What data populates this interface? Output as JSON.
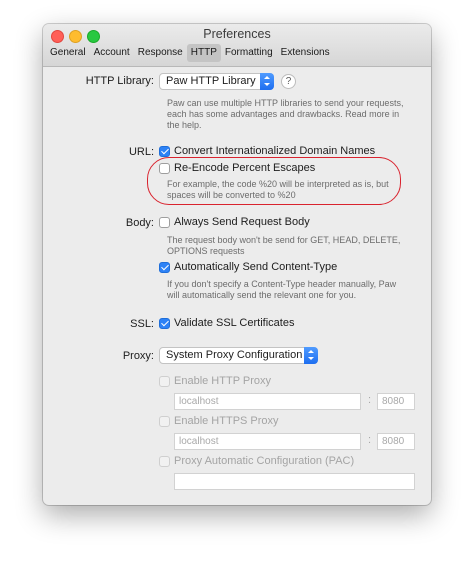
{
  "window": {
    "title": "Preferences",
    "tabs": [
      "General",
      "Account",
      "Response",
      "HTTP",
      "Formatting",
      "Extensions"
    ],
    "selected_tab": "HTTP"
  },
  "http_library": {
    "label": "HTTP Library:",
    "value": "Paw HTTP Library",
    "help": "?",
    "description": [
      "Paw can use multiple HTTP libraries to send your requests,",
      "each has some advantages and drawbacks. Read more in",
      "the help."
    ]
  },
  "url": {
    "label": "URL:",
    "convert_idn": {
      "label": "Convert Internationalized Domain Names",
      "checked": true
    },
    "reencode": {
      "label": "Re-Encode Percent Escapes",
      "checked": false
    },
    "reencode_description": [
      "For example, the code %20 will be interpreted as is, but",
      "spaces will be converted to %20"
    ]
  },
  "body": {
    "label": "Body:",
    "always_send": {
      "label": "Always Send Request Body",
      "checked": false
    },
    "always_send_description": [
      "The request body won't be send for GET, HEAD, DELETE,",
      "OPTIONS requests"
    ],
    "auto_content_type": {
      "label": "Automatically Send Content-Type",
      "checked": true
    },
    "auto_content_type_description": [
      "If you don't specify a Content-Type header manually, Paw",
      "will automatically send the relevant one for you."
    ]
  },
  "ssl": {
    "label": "SSL:",
    "validate": {
      "label": "Validate SSL Certificates",
      "checked": true
    }
  },
  "proxy": {
    "label": "Proxy:",
    "value": "System Proxy Configuration",
    "http": {
      "label": "Enable HTTP Proxy",
      "checked": false,
      "host_placeholder": "localhost",
      "port_placeholder": "8080"
    },
    "https": {
      "label": "Enable HTTPS Proxy",
      "checked": false,
      "host_placeholder": "localhost",
      "port_placeholder": "8080"
    },
    "pac": {
      "label": "Proxy Automatic Configuration (PAC)",
      "checked": false,
      "url_value": ""
    },
    "colon": ":"
  },
  "colors": {
    "accent": "#2d82f6",
    "annotation": "#d9232e"
  }
}
